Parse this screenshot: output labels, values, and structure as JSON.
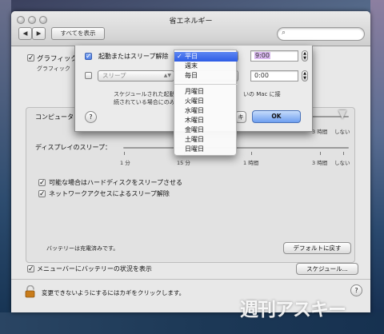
{
  "window": {
    "title": "省エネルギー",
    "show_all_label": "すべてを表示",
    "search_placeholder": ""
  },
  "graphics": {
    "checkbox_label": "グラフィック",
    "subtext": "グラフィック"
  },
  "sliders": {
    "computer_label": "コンピュータ",
    "display_label": "ディスプレイのスリープ：",
    "computer_ticks": [
      "3 時間",
      "しない"
    ],
    "display_ticks": [
      "1 分",
      "15 分",
      "1 時間",
      "3 時間",
      "しない"
    ]
  },
  "options": {
    "hard_disk_label": "可能な場合はハードディスクをスリープさせる",
    "network_wake_label": "ネットワークアクセスによるスリープ解除"
  },
  "battery_status": "バッテリーは充電済みです。",
  "restore_defaults_label": "デフォルトに戻す",
  "menubar_battery_label": "メニューバーにバッテリーの状況を表示",
  "schedule_button_label": "スケジュール...",
  "lock_text": "変更できないようにするにはカギをクリックします。",
  "help_label": "?",
  "sheet": {
    "row1_label": "起動またはスリープ解除",
    "row1_time": "9:00",
    "row2_popup": "スリープ",
    "row2_time": "0:00",
    "note_line1": "スケジュールされた起動",
    "note_line1_end": "いの Mac に接",
    "note_line2": "続されている場合にのみ",
    "cancel_label": "キ",
    "ok_label": "OK",
    "help_label": "?"
  },
  "day_menu": {
    "selected": "平日",
    "items": [
      "平日",
      "週末",
      "毎日",
      "月曜日",
      "火曜日",
      "水曜日",
      "木曜日",
      "金曜日",
      "土曜日",
      "日曜日"
    ]
  },
  "watermark": "週刊アスキー",
  "colors": {
    "accent": "#3a6ff0",
    "ok_button": "#8db6f3"
  }
}
